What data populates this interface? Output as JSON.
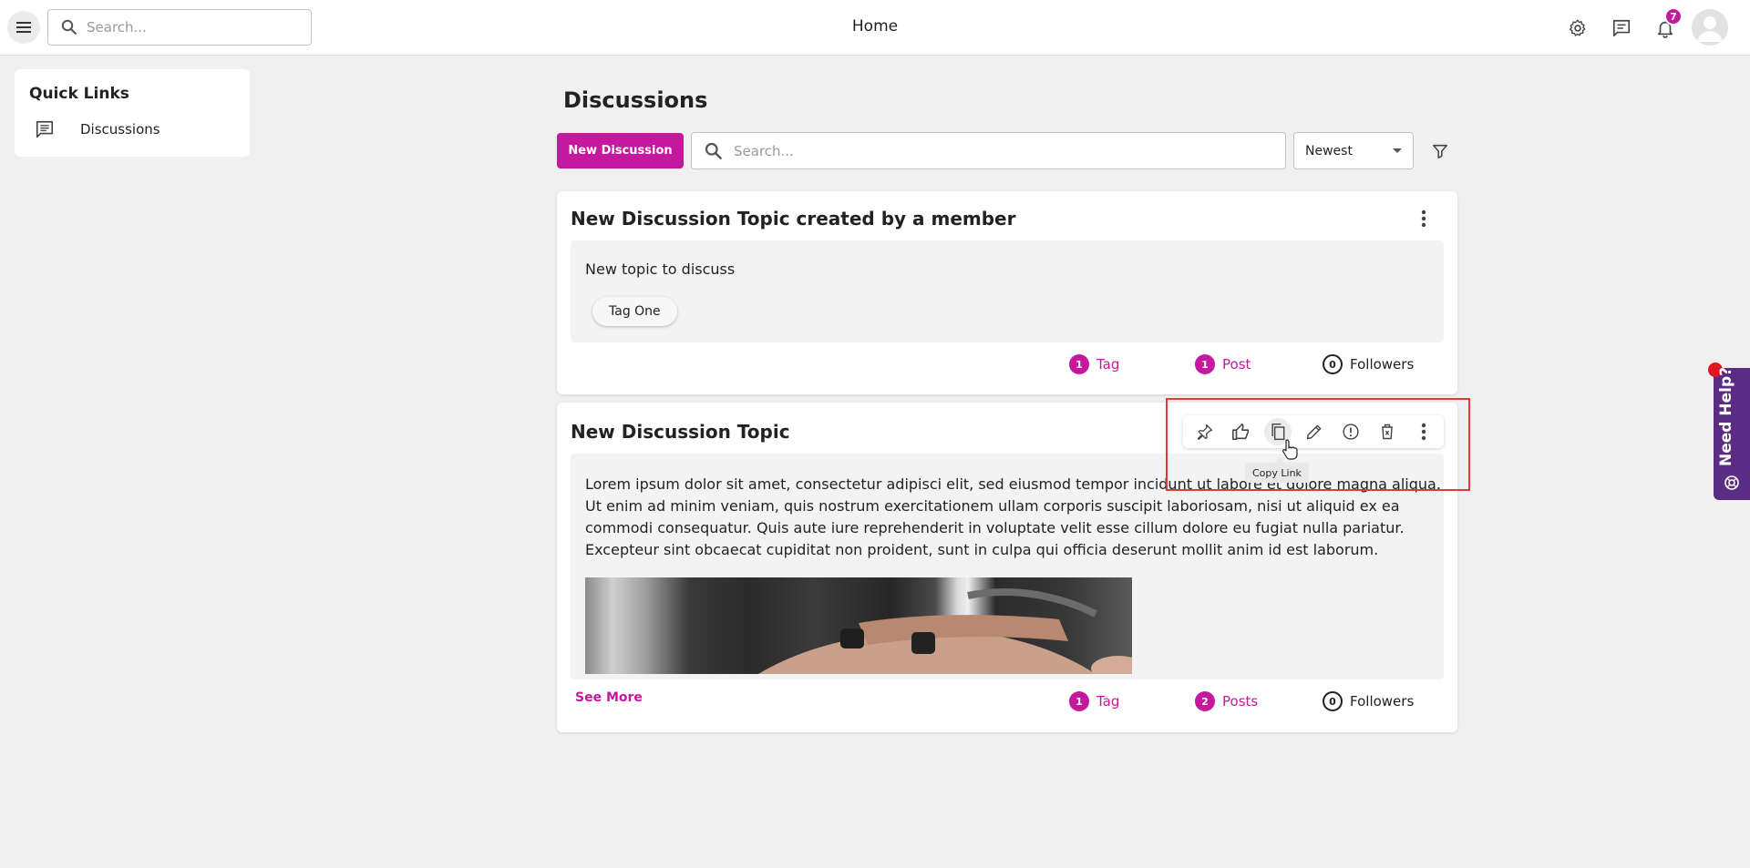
{
  "topbar": {
    "title": "Home",
    "search_placeholder": "Search...",
    "notification_count": "7"
  },
  "sidebar": {
    "title": "Quick Links",
    "items": [
      {
        "label": "Discussions",
        "icon": "chat-icon"
      }
    ]
  },
  "main": {
    "title": "Discussions",
    "new_button": "New Discussion",
    "search_placeholder": "Search...",
    "sort_value": "Newest"
  },
  "discussions": [
    {
      "title": "New Discussion Topic created by a member",
      "body": "New topic to discuss",
      "tags": [
        "Tag One"
      ],
      "stats": {
        "tag_count": "1",
        "tag_label": "Tag",
        "post_count": "1",
        "post_label": "Post",
        "follower_count": "0",
        "follower_label": "Followers"
      }
    },
    {
      "title": "New Discussion Topic",
      "body_lines": [
        "Lorem ipsum dolor sit amet, consectetur adipisci elit, sed eiusmod tempor incidunt ut labore et dolore magna aliqua.",
        "Ut enim ad minim veniam, quis nostrum exercitationem ullam corporis suscipit laboriosam, nisi ut aliquid ex ea",
        "commodi consequatur. Quis aute iure reprehenderit in voluptate velit esse cillum dolore eu fugiat nulla pariatur.",
        "Excepteur sint obcaecat cupiditat non proident, sunt in culpa qui officia deserunt mollit anim id est laborum."
      ],
      "see_more": "See More",
      "stats": {
        "tag_count": "1",
        "tag_label": "Tag",
        "post_count": "2",
        "post_label": "Posts",
        "follower_count": "0",
        "follower_label": "Followers"
      },
      "toolbar": {
        "actions": [
          "pin-icon",
          "like-icon",
          "copy-link-icon",
          "edit-icon",
          "report-icon",
          "delete-icon",
          "more-icon"
        ],
        "tooltip": "Copy Link"
      }
    }
  ],
  "help_widget": {
    "label": "Need Help?"
  },
  "colors": {
    "accent": "#c4189e",
    "help": "#5b2c83",
    "highlight": "#e03a3a",
    "background": "#f0f0f0"
  }
}
